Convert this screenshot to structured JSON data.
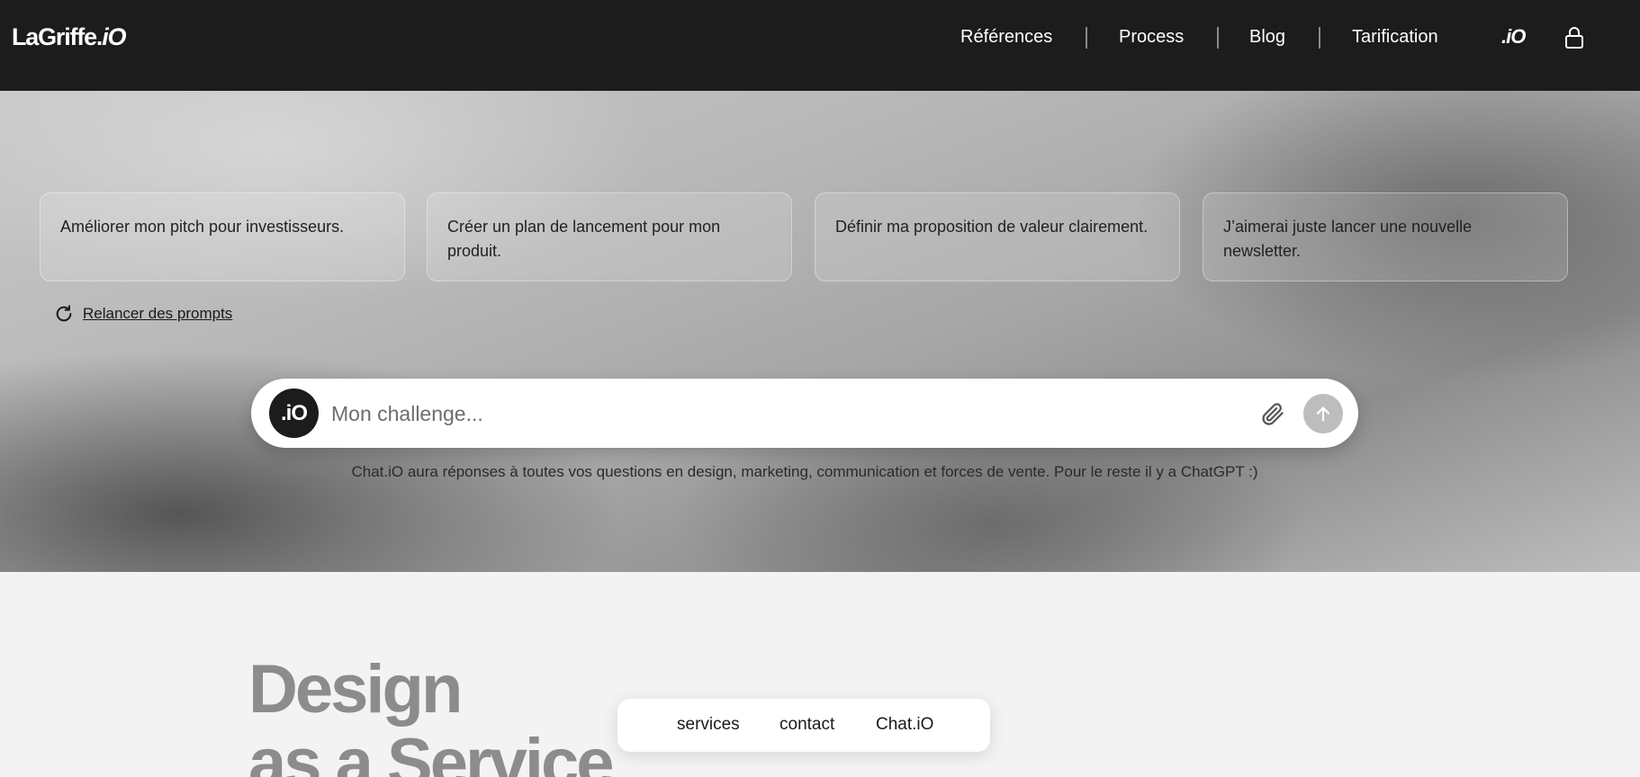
{
  "header": {
    "logo_main": "LaGriffe.",
    "logo_io": "iO",
    "nav": [
      {
        "label": "Références"
      },
      {
        "label": "Process"
      },
      {
        "label": "Blog"
      },
      {
        "label": "Tarification"
      }
    ],
    "io_badge": ".iO",
    "icons": [
      "lock-icon"
    ]
  },
  "hero": {
    "prompts": [
      {
        "text": "Améliorer mon pitch pour investisseurs."
      },
      {
        "text": "Créer un plan de lancement pour mon produit."
      },
      {
        "text": "Définir ma proposition de valeur clairement."
      },
      {
        "text": "J’aimerai juste lancer une nouvelle newsletter."
      }
    ],
    "reload_label": "Relancer des prompts",
    "chat": {
      "avatar_label": ".iO",
      "placeholder": "Mon challenge...",
      "value": "",
      "note": "Chat.iO aura réponses à toutes vos questions en design, marketing, communication et forces de vente. Pour le reste il y a ChatGPT :)"
    }
  },
  "section": {
    "headline_line1": "Design",
    "headline_line2": "as a Service"
  },
  "floating_nav": [
    {
      "label": "services"
    },
    {
      "label": "contact"
    },
    {
      "label": "Chat.iO"
    }
  ],
  "colors": {
    "topbar": "#1c1c1c",
    "headline": "#8c8c8c",
    "send_button": "#bdbdbd"
  }
}
